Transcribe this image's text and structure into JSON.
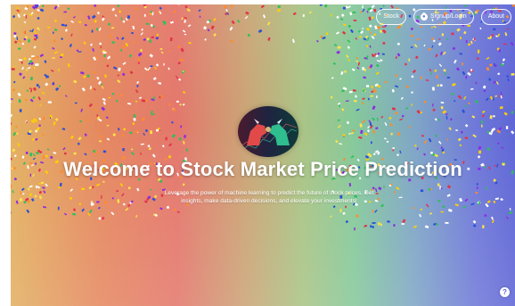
{
  "nav": {
    "stock_label": "Stock",
    "signup_label": "Signup/Login",
    "about_label": "About",
    "signup_icon": "user-circle-icon"
  },
  "hero": {
    "title": "Welcome to Stock Market Price Prediction",
    "subtitle": "Leverage the power of machine learning to predict the future of stock prices. Get insights, make data-driven decisions, and elevate your investments!",
    "image_icon": "bull-vs-bear-icon"
  },
  "help": {
    "icon": "help-icon",
    "glyph": "?"
  },
  "colors": {
    "gradient": [
      "#e3b062",
      "#e58860",
      "#e4776c",
      "#caa576",
      "#a9c486",
      "#86c99a",
      "#7fa6c6",
      "#6f79d8",
      "#5f66d6"
    ],
    "text": "#ffffff"
  }
}
